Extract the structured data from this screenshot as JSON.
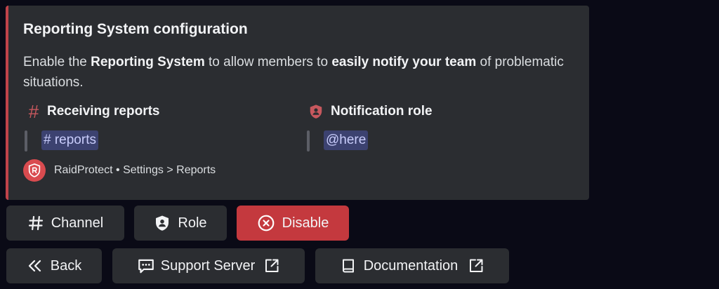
{
  "embed": {
    "accent_color": "#c0434a",
    "title": "Reporting System configuration",
    "description": {
      "part1": "Enable the ",
      "bold1": "Reporting System",
      "part2": " to allow members to ",
      "bold2": "easily notify your team",
      "part3": " of problematic situations."
    },
    "fields": [
      {
        "icon": "hash-icon",
        "name": "Receiving reports",
        "value": "# reports"
      },
      {
        "icon": "shield-user-icon",
        "name": "Notification role",
        "value": "@here"
      }
    ],
    "footer": {
      "icon": "raidprotect-logo",
      "text": "RaidProtect • Settings > Reports"
    }
  },
  "buttons": {
    "row1": [
      {
        "icon": "hash-icon",
        "label": "Channel",
        "style": "secondary"
      },
      {
        "icon": "shield-user-icon",
        "label": "Role",
        "style": "secondary"
      },
      {
        "icon": "circle-x-icon",
        "label": "Disable",
        "style": "danger",
        "color": "#c4393e"
      }
    ],
    "row2": [
      {
        "icon": "chevrons-left-icon",
        "label": "Back"
      },
      {
        "icon": "message-icon",
        "label": "Support Server",
        "trailing_icon": "external-link-icon"
      },
      {
        "icon": "book-icon",
        "label": "Documentation",
        "trailing_icon": "external-link-icon"
      }
    ]
  },
  "colors": {
    "background": "#0a0a16",
    "embed_background": "#2b2d31",
    "mention_background": "#3c4270",
    "mention_text": "#c9cdfb",
    "danger": "#c4393e"
  }
}
